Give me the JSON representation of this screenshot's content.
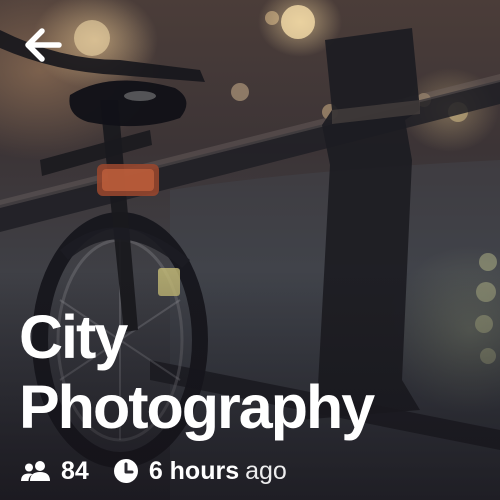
{
  "header": {
    "back_icon": "arrow-left-icon"
  },
  "post": {
    "title_line1": "City",
    "title_line2": "Photography",
    "members_icon": "users-icon",
    "members_count": "84",
    "time_icon": "clock-icon",
    "time_value": "6 hours",
    "time_suffix": "ago"
  },
  "colors": {
    "text": "#ffffff",
    "background": "#2f2d33"
  }
}
